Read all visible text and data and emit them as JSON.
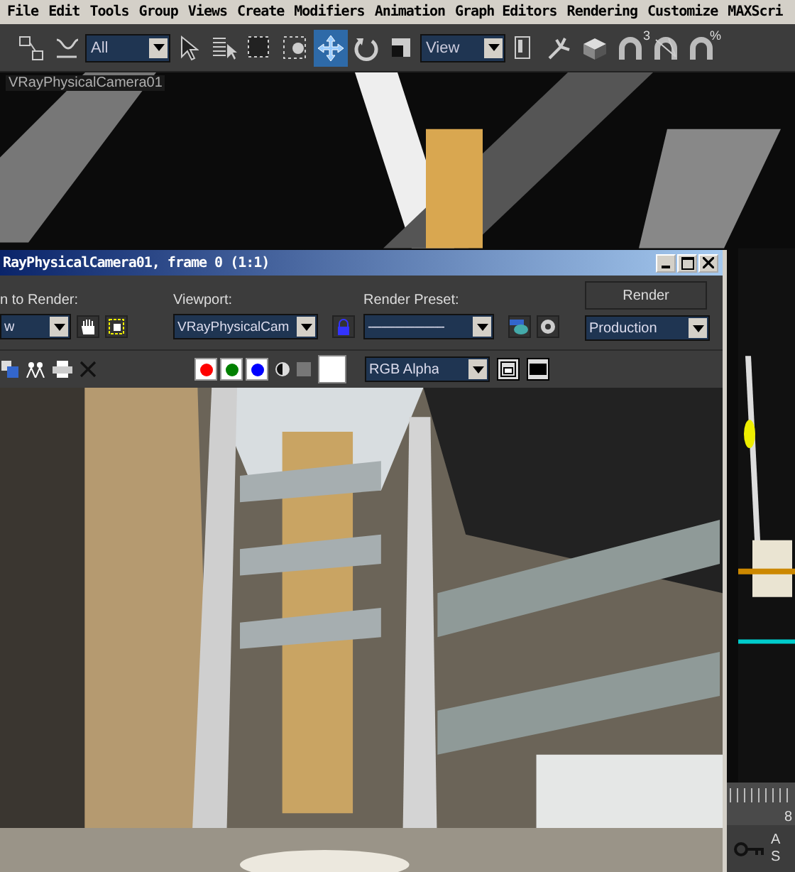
{
  "menu": [
    "File",
    "Edit",
    "Tools",
    "Group",
    "Views",
    "Create",
    "Modifiers",
    "Animation",
    "Graph Editors",
    "Rendering",
    "Customize",
    "MAXScri"
  ],
  "toolbar": [
    {
      "kind": "link",
      "selected": false
    },
    {
      "kind": "bind",
      "selected": false
    },
    {
      "kind": "dropdown",
      "value": "All"
    },
    {
      "kind": "select",
      "selected": false
    },
    {
      "kind": "select-name",
      "selected": false
    },
    {
      "kind": "region",
      "selected": false
    },
    {
      "kind": "window",
      "selected": false
    },
    {
      "kind": "move",
      "selected": true
    },
    {
      "kind": "rotate",
      "selected": false
    },
    {
      "kind": "scale",
      "selected": false
    },
    {
      "kind": "dropdown",
      "value": "View"
    },
    {
      "kind": "pivot",
      "selected": false
    },
    {
      "kind": "manipulate",
      "selected": false
    },
    {
      "kind": "keyboard",
      "selected": false
    },
    {
      "kind": "snap",
      "selected": false,
      "label": "3"
    },
    {
      "kind": "angle-snap",
      "selected": false
    },
    {
      "kind": "percent-snap",
      "selected": false,
      "label": "%"
    }
  ],
  "viewport": {
    "label": "VRayPhysicalCamera01"
  },
  "render_window": {
    "title": "RayPhysicalCamera01, frame 0 (1:1)",
    "area_label": "n to Render:",
    "area_value": "w",
    "viewport_label": "Viewport:",
    "viewport_value": "VRayPhysicalCam",
    "preset_label": "Render Preset:",
    "preset_value": "-----------------------",
    "render_button": "Render",
    "mode_value": "Production",
    "channels": [
      {
        "color": "#ff0000"
      },
      {
        "color": "#008000"
      },
      {
        "color": "#0000ff"
      }
    ],
    "display_channel": "RGB Alpha"
  },
  "timeline": {
    "frame": "8",
    "labels": [
      "A",
      "S"
    ]
  }
}
